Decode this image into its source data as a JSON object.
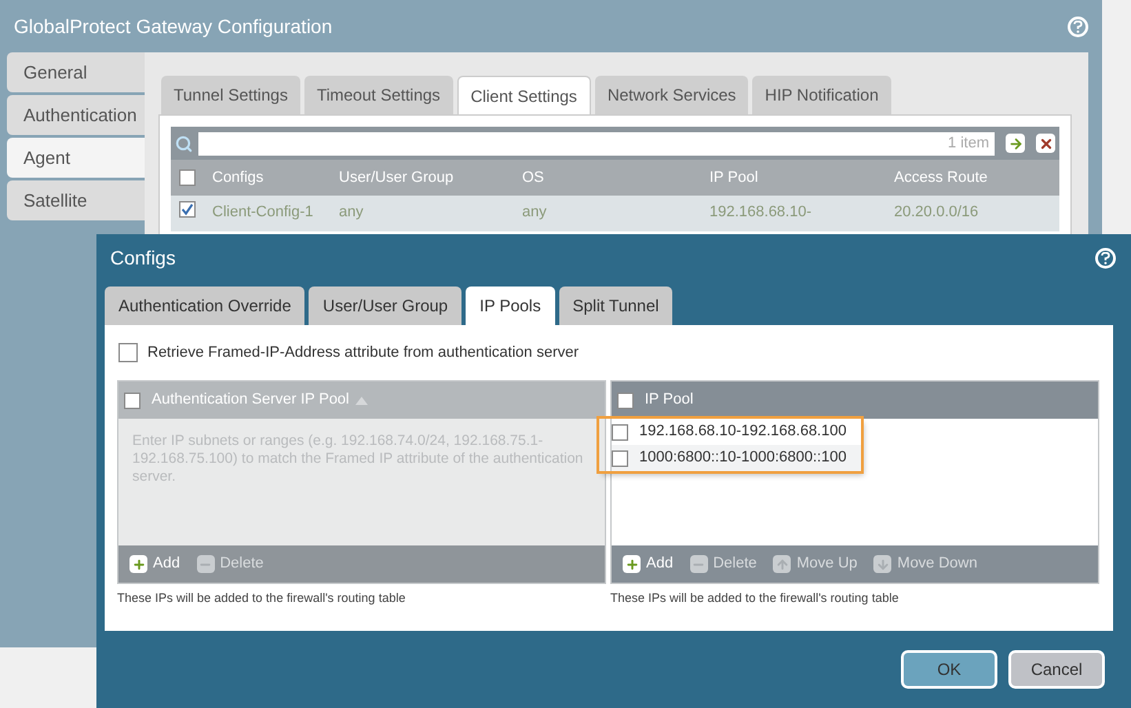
{
  "window": {
    "title": "GlobalProtect Gateway Configuration"
  },
  "sidebar": {
    "items": [
      {
        "label": "General",
        "selected": false
      },
      {
        "label": "Authentication",
        "selected": false
      },
      {
        "label": "Agent",
        "selected": true
      },
      {
        "label": "Satellite",
        "selected": false
      }
    ]
  },
  "tabs": [
    {
      "label": "Tunnel Settings",
      "selected": false
    },
    {
      "label": "Timeout Settings",
      "selected": false
    },
    {
      "label": "Client Settings",
      "selected": true
    },
    {
      "label": "Network Services",
      "selected": false
    },
    {
      "label": "HIP Notification",
      "selected": false
    }
  ],
  "search": {
    "count": "1 item"
  },
  "table": {
    "select_all_checked": false,
    "columns": [
      "Configs",
      "User/User Group",
      "OS",
      "IP Pool",
      "Access Route"
    ],
    "rows": [
      {
        "checked": true,
        "cells": [
          "Client-Config-1",
          "any",
          "any",
          "192.168.68.10-",
          "20.20.0.0/16"
        ]
      }
    ]
  },
  "dialog": {
    "title": "Configs",
    "tabs": [
      {
        "label": "Authentication Override",
        "selected": false
      },
      {
        "label": "User/User Group",
        "selected": false
      },
      {
        "label": "IP Pools",
        "selected": true
      },
      {
        "label": "Split Tunnel",
        "selected": false
      }
    ],
    "retrieve": {
      "label": "Retrieve Framed-IP-Address attribute from authentication server",
      "checked": false
    },
    "auth_pool": {
      "select_all_checked": false,
      "header": "Authentication Server IP Pool",
      "placeholder": "Enter IP subnets or ranges (e.g. 192.168.74.0/24, 192.168.75.1-192.168.75.100) to match the Framed IP attribute of the authentication server.",
      "actions": [
        {
          "kind": "add",
          "label": "Add",
          "disabled": false
        },
        {
          "kind": "delete",
          "label": "Delete",
          "disabled": true
        }
      ],
      "note": "These IPs will be added to the firewall's routing table"
    },
    "ip_pool": {
      "select_all_checked": false,
      "header": "IP Pool",
      "highlighted": true,
      "rows": [
        {
          "value": "192.168.68.10-192.168.68.100",
          "checked": false
        },
        {
          "value": "1000:6800::10-1000:6800::100",
          "checked": false
        }
      ],
      "actions": [
        {
          "kind": "add",
          "label": "Add",
          "disabled": false
        },
        {
          "kind": "delete",
          "label": "Delete",
          "disabled": true
        },
        {
          "kind": "up",
          "label": "Move Up",
          "disabled": true
        },
        {
          "kind": "down",
          "label": "Move Down",
          "disabled": true
        }
      ],
      "note": "These IPs will be added to the firewall's routing table"
    },
    "buttons": [
      {
        "label": "OK",
        "kind": "primary"
      },
      {
        "label": "Cancel",
        "kind": "secondary"
      }
    ]
  }
}
